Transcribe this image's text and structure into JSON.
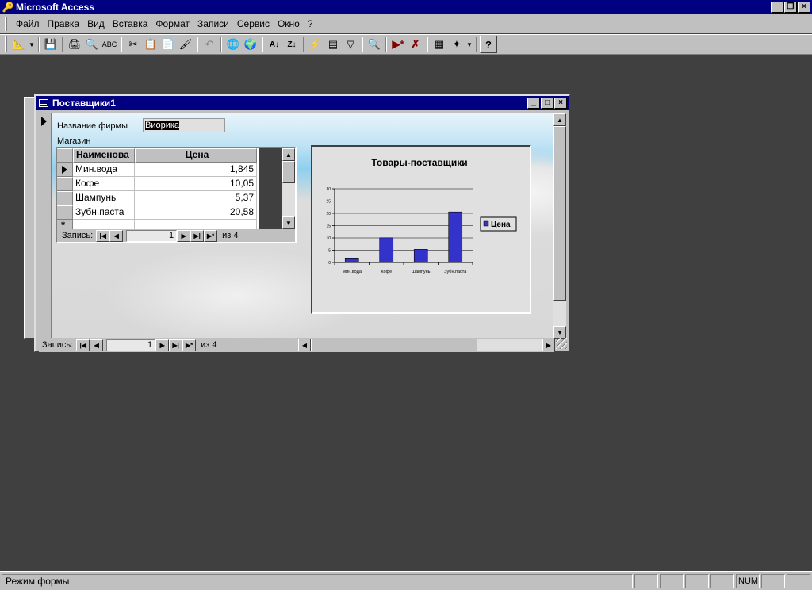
{
  "app": {
    "title": "Microsoft Access"
  },
  "menu": [
    "Файл",
    "Правка",
    "Вид",
    "Вставка",
    "Формат",
    "Записи",
    "Сервис",
    "Окно",
    "?"
  ],
  "toolbar": [
    "design-view",
    "save",
    "print",
    "print-preview",
    "spelling",
    "cut",
    "copy",
    "paste",
    "format-painter",
    "undo",
    "hyperlink",
    "web-toolbar",
    "sort-ascending",
    "sort-descending",
    "filter-by-selection",
    "filter-by-form",
    "apply-filter",
    "find",
    "new-record",
    "delete-record",
    "properties",
    "database-window",
    "new-object",
    "help"
  ],
  "form": {
    "title": "Поставщики1",
    "firm_label": "Название фирмы",
    "firm_value": "Виорика",
    "store_label": "Магазин",
    "nav_label": "Запись:",
    "nav_current": "1",
    "nav_of": "из  4"
  },
  "subform": {
    "columns": [
      "Наименова",
      "Цена"
    ],
    "rows": [
      {
        "name": "Мин.вода",
        "price": "1,845"
      },
      {
        "name": "Кофе",
        "price": "10,05"
      },
      {
        "name": "Шампунь",
        "price": "5,37"
      },
      {
        "name": "Зубн.паста",
        "price": "20,58"
      }
    ],
    "nav_label": "Запись:",
    "nav_current": "1",
    "nav_of": "из  4"
  },
  "chart_data": {
    "type": "bar",
    "title": "Товары-поставщики",
    "categories": [
      "Мин.вода",
      "Кофе",
      "Шампунь",
      "Зубн.паста"
    ],
    "series": [
      {
        "name": "Цена",
        "values": [
          1.845,
          10.05,
          5.37,
          20.58
        ],
        "color": "#3333cc"
      }
    ],
    "yticks": [
      0,
      5,
      10,
      15,
      20,
      25,
      30
    ],
    "ylim": [
      0,
      30
    ],
    "grid": true,
    "legend": "right"
  },
  "status": {
    "text": "Режим формы",
    "num": "NUM"
  }
}
